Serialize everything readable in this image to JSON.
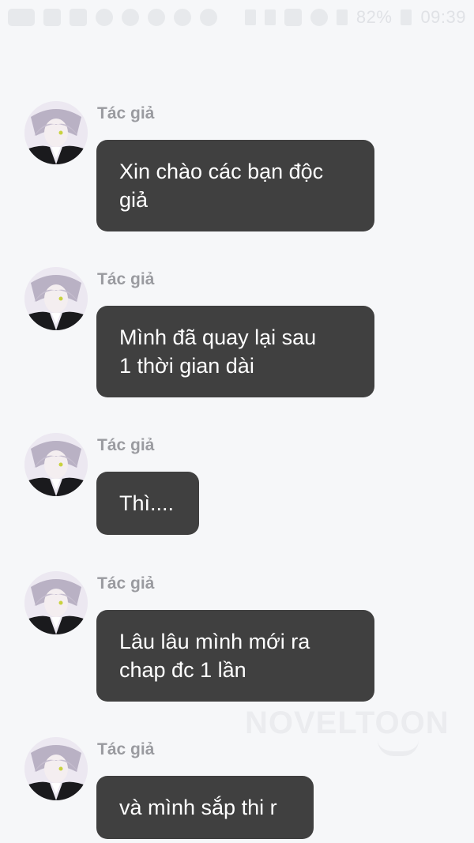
{
  "status_bar": {
    "battery_percent": "82%",
    "time": "09:39",
    "icons": [
      "chat-icon",
      "image-icon",
      "message-icon",
      "pinterest-icon",
      "face-icon",
      "face-icon",
      "face-icon",
      "face-icon",
      "nfc-icon",
      "mute-icon",
      "alarm-icon",
      "wifi-icon",
      "signal-icon",
      "battery-icon"
    ]
  },
  "messages": [
    {
      "sender": "Tác giả",
      "text": "Xin chào các bạn độc\ngiả"
    },
    {
      "sender": "Tác giả",
      "text": "Mình đã quay lại sau\n1 thời gian dài"
    },
    {
      "sender": "Tác giả",
      "text": "Thì...."
    },
    {
      "sender": "Tác giả",
      "text": "Lâu lâu mình mới ra\nchap đc 1 lần"
    },
    {
      "sender": "Tác giả",
      "text": "và mình sắp thi r"
    }
  ],
  "watermark": {
    "text": "NOVELTOON"
  },
  "colors": {
    "background": "#f6f7f9",
    "bubble": "#404040",
    "bubble_text": "#ffffff",
    "sender": "#9a9ba0"
  }
}
